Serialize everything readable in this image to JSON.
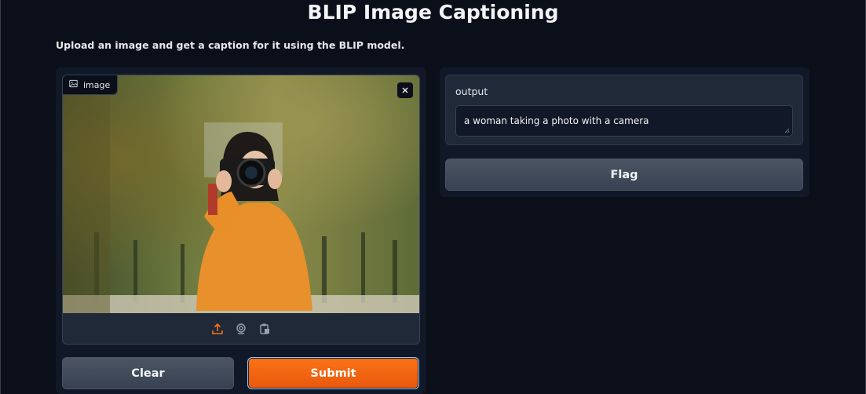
{
  "header": {
    "title": "BLIP Image Captioning",
    "description": "Upload an image and get a caption for it using the BLIP model."
  },
  "image_input": {
    "label": "image",
    "label_icon": "image-icon",
    "close_icon": "close-icon",
    "toolbar_icons": [
      "upload-icon",
      "webcam-icon",
      "clipboard-icon"
    ],
    "accent_color": "#f97316"
  },
  "buttons": {
    "clear": "Clear",
    "submit": "Submit",
    "flag": "Flag"
  },
  "output": {
    "label": "output",
    "value": "a woman taking a photo with a camera"
  },
  "colors": {
    "background": "#0b0f19",
    "panel": "#111827",
    "submit": "#f97316"
  }
}
